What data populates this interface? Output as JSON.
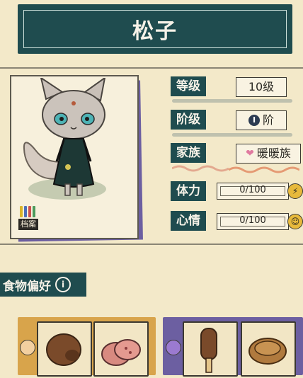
{
  "header": {
    "title": "松子"
  },
  "portrait": {
    "archive_label": "档案",
    "archive_bar_colors": [
      "#d9b52a",
      "#4c6fb7",
      "#cc4f4f",
      "#4c9a5c"
    ]
  },
  "stats": {
    "level": {
      "label": "等级",
      "value": "10级"
    },
    "stage": {
      "label": "阶级",
      "badge": "I",
      "value": "阶"
    },
    "family": {
      "label": "家族",
      "value": "暖暖族"
    },
    "stamina": {
      "label": "体力",
      "value": "0/100"
    },
    "mood": {
      "label": "心情",
      "value": "0/100"
    }
  },
  "food": {
    "title": "食物偏好",
    "liked_panel_color": "#d8a44b",
    "disliked_panel_color": "#6c5fa1"
  },
  "colors": {
    "background": "#f3e9c9",
    "header": "#1f4c4f",
    "accent_purple": "#6c5fa1",
    "accent_orange": "#d8a44b"
  }
}
